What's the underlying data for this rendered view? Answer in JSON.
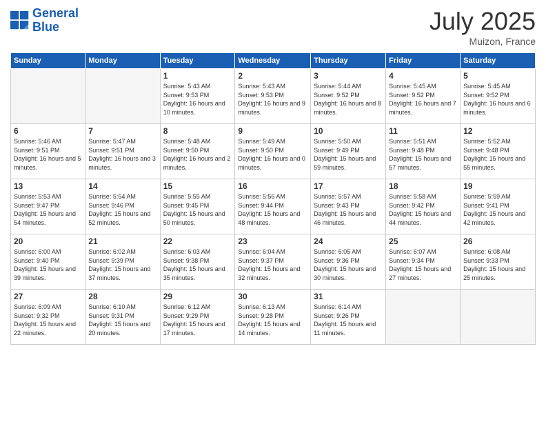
{
  "logo": {
    "line1": "General",
    "line2": "Blue"
  },
  "title": "July 2025",
  "location": "Muizon, France",
  "days_header": [
    "Sunday",
    "Monday",
    "Tuesday",
    "Wednesday",
    "Thursday",
    "Friday",
    "Saturday"
  ],
  "weeks": [
    [
      {
        "day": "",
        "sunrise": "",
        "sunset": "",
        "daylight": ""
      },
      {
        "day": "",
        "sunrise": "",
        "sunset": "",
        "daylight": ""
      },
      {
        "day": "1",
        "sunrise": "Sunrise: 5:43 AM",
        "sunset": "Sunset: 9:53 PM",
        "daylight": "Daylight: 16 hours and 10 minutes."
      },
      {
        "day": "2",
        "sunrise": "Sunrise: 5:43 AM",
        "sunset": "Sunset: 9:53 PM",
        "daylight": "Daylight: 16 hours and 9 minutes."
      },
      {
        "day": "3",
        "sunrise": "Sunrise: 5:44 AM",
        "sunset": "Sunset: 9:52 PM",
        "daylight": "Daylight: 16 hours and 8 minutes."
      },
      {
        "day": "4",
        "sunrise": "Sunrise: 5:45 AM",
        "sunset": "Sunset: 9:52 PM",
        "daylight": "Daylight: 16 hours and 7 minutes."
      },
      {
        "day": "5",
        "sunrise": "Sunrise: 5:45 AM",
        "sunset": "Sunset: 9:52 PM",
        "daylight": "Daylight: 16 hours and 6 minutes."
      }
    ],
    [
      {
        "day": "6",
        "sunrise": "Sunrise: 5:46 AM",
        "sunset": "Sunset: 9:51 PM",
        "daylight": "Daylight: 16 hours and 5 minutes."
      },
      {
        "day": "7",
        "sunrise": "Sunrise: 5:47 AM",
        "sunset": "Sunset: 9:51 PM",
        "daylight": "Daylight: 16 hours and 3 minutes."
      },
      {
        "day": "8",
        "sunrise": "Sunrise: 5:48 AM",
        "sunset": "Sunset: 9:50 PM",
        "daylight": "Daylight: 16 hours and 2 minutes."
      },
      {
        "day": "9",
        "sunrise": "Sunrise: 5:49 AM",
        "sunset": "Sunset: 9:50 PM",
        "daylight": "Daylight: 16 hours and 0 minutes."
      },
      {
        "day": "10",
        "sunrise": "Sunrise: 5:50 AM",
        "sunset": "Sunset: 9:49 PM",
        "daylight": "Daylight: 15 hours and 59 minutes."
      },
      {
        "day": "11",
        "sunrise": "Sunrise: 5:51 AM",
        "sunset": "Sunset: 9:48 PM",
        "daylight": "Daylight: 15 hours and 57 minutes."
      },
      {
        "day": "12",
        "sunrise": "Sunrise: 5:52 AM",
        "sunset": "Sunset: 9:48 PM",
        "daylight": "Daylight: 15 hours and 55 minutes."
      }
    ],
    [
      {
        "day": "13",
        "sunrise": "Sunrise: 5:53 AM",
        "sunset": "Sunset: 9:47 PM",
        "daylight": "Daylight: 15 hours and 54 minutes."
      },
      {
        "day": "14",
        "sunrise": "Sunrise: 5:54 AM",
        "sunset": "Sunset: 9:46 PM",
        "daylight": "Daylight: 15 hours and 52 minutes."
      },
      {
        "day": "15",
        "sunrise": "Sunrise: 5:55 AM",
        "sunset": "Sunset: 9:45 PM",
        "daylight": "Daylight: 15 hours and 50 minutes."
      },
      {
        "day": "16",
        "sunrise": "Sunrise: 5:56 AM",
        "sunset": "Sunset: 9:44 PM",
        "daylight": "Daylight: 15 hours and 48 minutes."
      },
      {
        "day": "17",
        "sunrise": "Sunrise: 5:57 AM",
        "sunset": "Sunset: 9:43 PM",
        "daylight": "Daylight: 15 hours and 46 minutes."
      },
      {
        "day": "18",
        "sunrise": "Sunrise: 5:58 AM",
        "sunset": "Sunset: 9:42 PM",
        "daylight": "Daylight: 15 hours and 44 minutes."
      },
      {
        "day": "19",
        "sunrise": "Sunrise: 5:59 AM",
        "sunset": "Sunset: 9:41 PM",
        "daylight": "Daylight: 15 hours and 42 minutes."
      }
    ],
    [
      {
        "day": "20",
        "sunrise": "Sunrise: 6:00 AM",
        "sunset": "Sunset: 9:40 PM",
        "daylight": "Daylight: 15 hours and 39 minutes."
      },
      {
        "day": "21",
        "sunrise": "Sunrise: 6:02 AM",
        "sunset": "Sunset: 9:39 PM",
        "daylight": "Daylight: 15 hours and 37 minutes."
      },
      {
        "day": "22",
        "sunrise": "Sunrise: 6:03 AM",
        "sunset": "Sunset: 9:38 PM",
        "daylight": "Daylight: 15 hours and 35 minutes."
      },
      {
        "day": "23",
        "sunrise": "Sunrise: 6:04 AM",
        "sunset": "Sunset: 9:37 PM",
        "daylight": "Daylight: 15 hours and 32 minutes."
      },
      {
        "day": "24",
        "sunrise": "Sunrise: 6:05 AM",
        "sunset": "Sunset: 9:36 PM",
        "daylight": "Daylight: 15 hours and 30 minutes."
      },
      {
        "day": "25",
        "sunrise": "Sunrise: 6:07 AM",
        "sunset": "Sunset: 9:34 PM",
        "daylight": "Daylight: 15 hours and 27 minutes."
      },
      {
        "day": "26",
        "sunrise": "Sunrise: 6:08 AM",
        "sunset": "Sunset: 9:33 PM",
        "daylight": "Daylight: 15 hours and 25 minutes."
      }
    ],
    [
      {
        "day": "27",
        "sunrise": "Sunrise: 6:09 AM",
        "sunset": "Sunset: 9:32 PM",
        "daylight": "Daylight: 15 hours and 22 minutes."
      },
      {
        "day": "28",
        "sunrise": "Sunrise: 6:10 AM",
        "sunset": "Sunset: 9:31 PM",
        "daylight": "Daylight: 15 hours and 20 minutes."
      },
      {
        "day": "29",
        "sunrise": "Sunrise: 6:12 AM",
        "sunset": "Sunset: 9:29 PM",
        "daylight": "Daylight: 15 hours and 17 minutes."
      },
      {
        "day": "30",
        "sunrise": "Sunrise: 6:13 AM",
        "sunset": "Sunset: 9:28 PM",
        "daylight": "Daylight: 15 hours and 14 minutes."
      },
      {
        "day": "31",
        "sunrise": "Sunrise: 6:14 AM",
        "sunset": "Sunset: 9:26 PM",
        "daylight": "Daylight: 15 hours and 11 minutes."
      },
      {
        "day": "",
        "sunrise": "",
        "sunset": "",
        "daylight": ""
      },
      {
        "day": "",
        "sunrise": "",
        "sunset": "",
        "daylight": ""
      }
    ]
  ]
}
